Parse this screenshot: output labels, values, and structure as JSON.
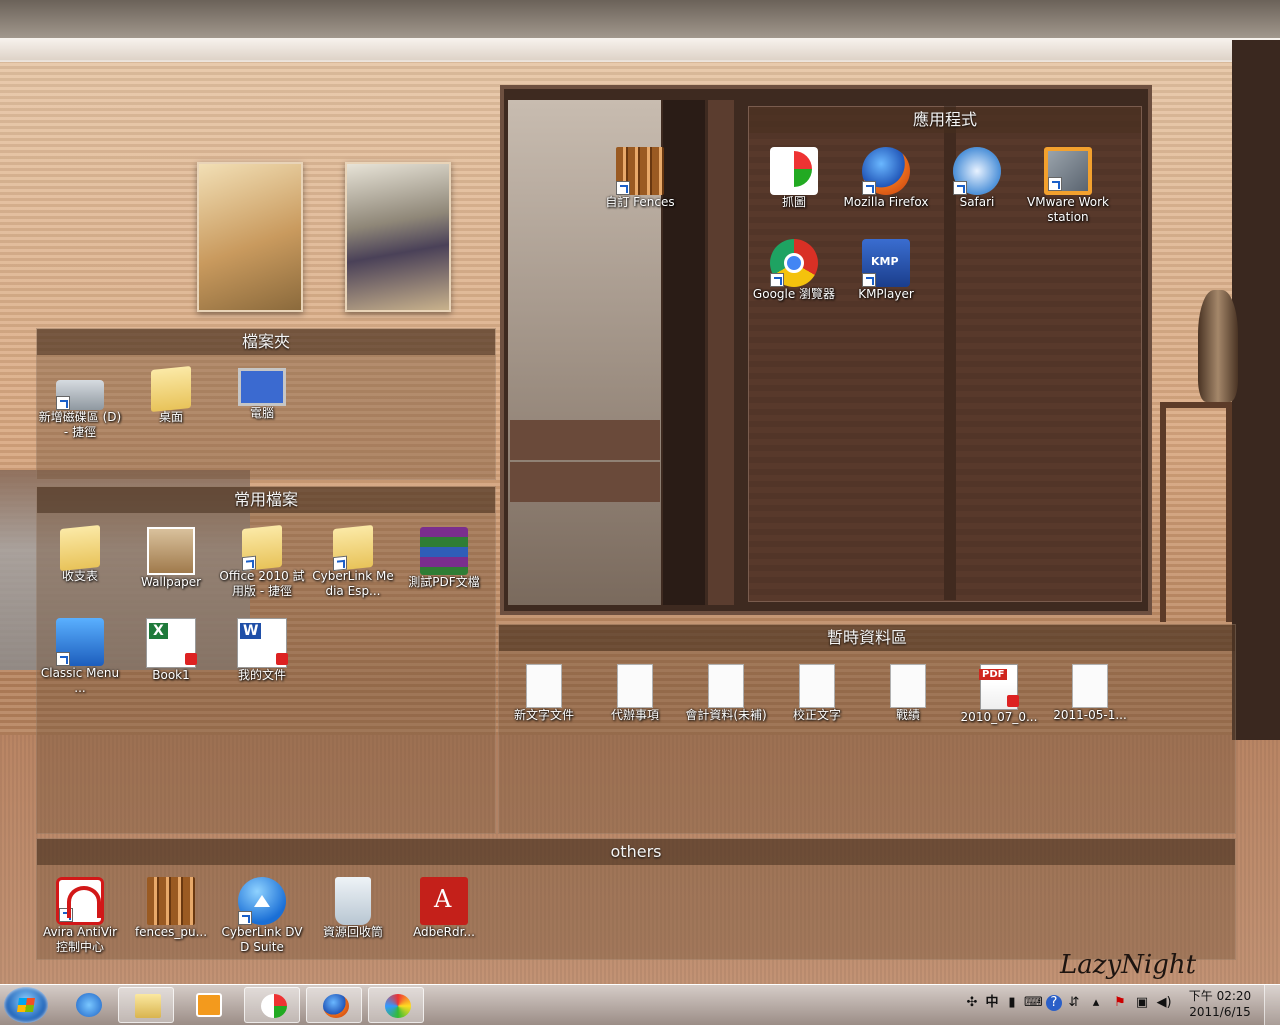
{
  "desktop": {
    "signature": "LazyNight",
    "fences": {
      "apps": {
        "title": "應用程式",
        "icons": [
          {
            "label": "抓圖",
            "icon": "screen-capture-icon"
          },
          {
            "label": "Mozilla Firefox",
            "icon": "firefox-icon"
          },
          {
            "label": "Safari",
            "icon": "safari-icon"
          },
          {
            "label": "VMware Workstation",
            "icon": "vmware-icon"
          },
          {
            "label": "Google 瀏覽器",
            "icon": "chrome-icon"
          },
          {
            "label": "KMPlayer",
            "icon": "kmplayer-icon"
          }
        ]
      },
      "loose": {
        "icons": [
          {
            "label": "自訂 Fences",
            "icon": "fences-icon"
          }
        ]
      },
      "folders": {
        "title": "檔案夾",
        "icons": [
          {
            "label": "新增磁碟區 (D) - 捷徑",
            "icon": "drive-icon"
          },
          {
            "label": "桌面",
            "icon": "folder-icon"
          },
          {
            "label": "電腦",
            "icon": "computer-icon"
          }
        ]
      },
      "common": {
        "title": "常用檔案",
        "icons": [
          {
            "label": "收支表",
            "icon": "folder-icon"
          },
          {
            "label": "Wallpaper",
            "icon": "image-folder-icon"
          },
          {
            "label": "Office 2010 試用版 - 捷徑",
            "icon": "folder-icon"
          },
          {
            "label": "CyberLink Media Esp...",
            "icon": "folder-icon"
          },
          {
            "label": "測試PDF文檔",
            "icon": "winrar-icon"
          },
          {
            "label": "Classic Menu ...",
            "icon": "classic-menu-icon"
          },
          {
            "label": "Book1",
            "icon": "excel-icon"
          },
          {
            "label": "我的文件",
            "icon": "word-icon"
          }
        ]
      },
      "temp": {
        "title": "暫時資料區",
        "icons": [
          {
            "label": "新文字文件",
            "icon": "text-file-icon"
          },
          {
            "label": "代辦事項",
            "icon": "text-file-icon"
          },
          {
            "label": "會計資料(未補)",
            "icon": "text-file-icon"
          },
          {
            "label": "校正文字",
            "icon": "text-file-icon"
          },
          {
            "label": "戰績",
            "icon": "text-file-icon"
          },
          {
            "label": "2010_07_0...",
            "icon": "pdf-icon"
          },
          {
            "label": "2011-05-1...",
            "icon": "document-icon"
          }
        ]
      },
      "others": {
        "title": "others",
        "icons": [
          {
            "label": "Avira AntiVir 控制中心",
            "icon": "avira-icon"
          },
          {
            "label": "fences_pu...",
            "icon": "fences-icon"
          },
          {
            "label": "CyberLink DVD Suite",
            "icon": "cyberlink-icon"
          },
          {
            "label": "資源回收筒",
            "icon": "recycle-bin-icon"
          },
          {
            "label": "AdbeRdr...",
            "icon": "acrobat-icon"
          }
        ]
      }
    }
  },
  "taskbar": {
    "pinned": [
      {
        "name": "internet-explorer-icon"
      },
      {
        "name": "windows-explorer-icon",
        "active": true
      },
      {
        "name": "media-player-icon"
      },
      {
        "name": "screen-capture-icon"
      },
      {
        "name": "firefox-icon"
      },
      {
        "name": "paint-icon"
      }
    ],
    "tray": {
      "ime": "中",
      "icons": [
        "ime-icon",
        "fullwidth-icon",
        "keyboard-icon",
        "help-icon",
        "arrows-icon",
        "show-hidden-icon",
        "flag-icon",
        "network-icon",
        "volume-icon"
      ]
    },
    "clock": {
      "time": "下午 02:20",
      "date": "2011/6/15"
    }
  }
}
